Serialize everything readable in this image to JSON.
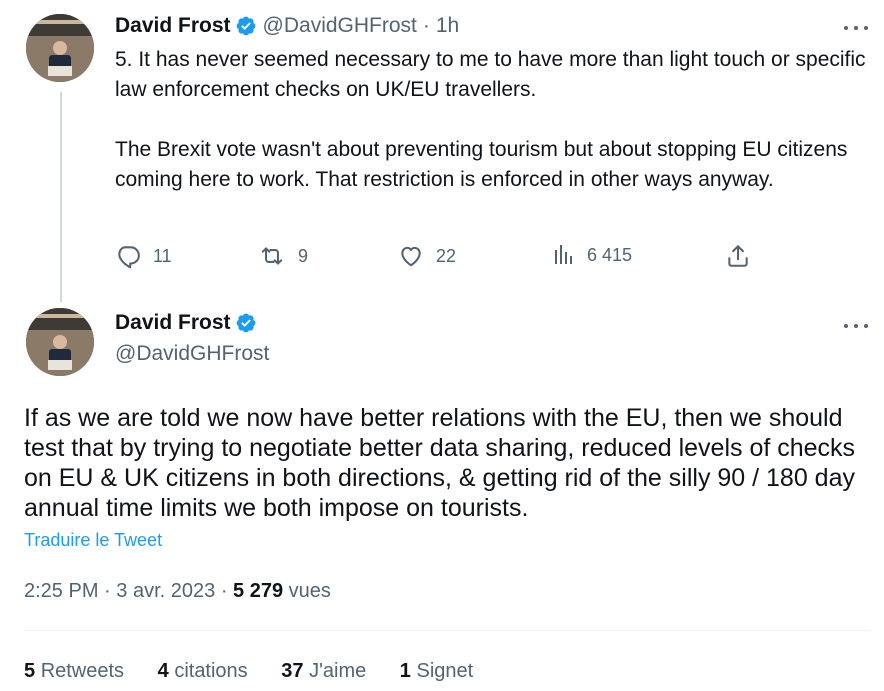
{
  "reply_tweet": {
    "display_name": "David Frost",
    "handle": "@DavidGHFrost",
    "separator": "·",
    "time": "1h",
    "paragraphs": [
      "5. It has never seemed necessary to me to have more than light touch or specific law enforcement checks on UK/EU travellers.",
      "The Brexit vote wasn't about preventing tourism but about stopping EU citizens coming here to work. That restriction is enforced in other ways anyway."
    ],
    "actions": {
      "replies": "11",
      "retweets": "9",
      "likes": "22",
      "views": "6 415"
    }
  },
  "main_tweet": {
    "display_name": "David Frost",
    "handle": "@DavidGHFrost",
    "text": "If as we are told we now have better relations with the EU, then we should test that by trying to negotiate better data sharing, reduced levels of checks on EU & UK citizens in both directions, & getting rid of the silly 90 / 180 day annual time limits we both impose on tourists.",
    "translate_label": "Traduire le Tweet",
    "time": "2:25 PM",
    "separator": "·",
    "date": "3 avr. 2023",
    "views_count": "5 279",
    "views_label": "vues",
    "stats": {
      "retweets_count": "5",
      "retweets_label": "Retweets",
      "quotes_count": "4",
      "quotes_label": "citations",
      "likes_count": "37",
      "likes_label": "J'aime",
      "bookmarks_count": "1",
      "bookmarks_label": "Signet"
    }
  },
  "colors": {
    "text": "#0f1419",
    "secondary": "#536471",
    "accent": "#1d9bf0",
    "verified": "#1d9bf0",
    "divider": "#eff3f4"
  },
  "icons": [
    "verified-badge-icon",
    "more-icon",
    "reply-icon",
    "retweet-icon",
    "like-icon",
    "views-icon",
    "share-icon"
  ]
}
